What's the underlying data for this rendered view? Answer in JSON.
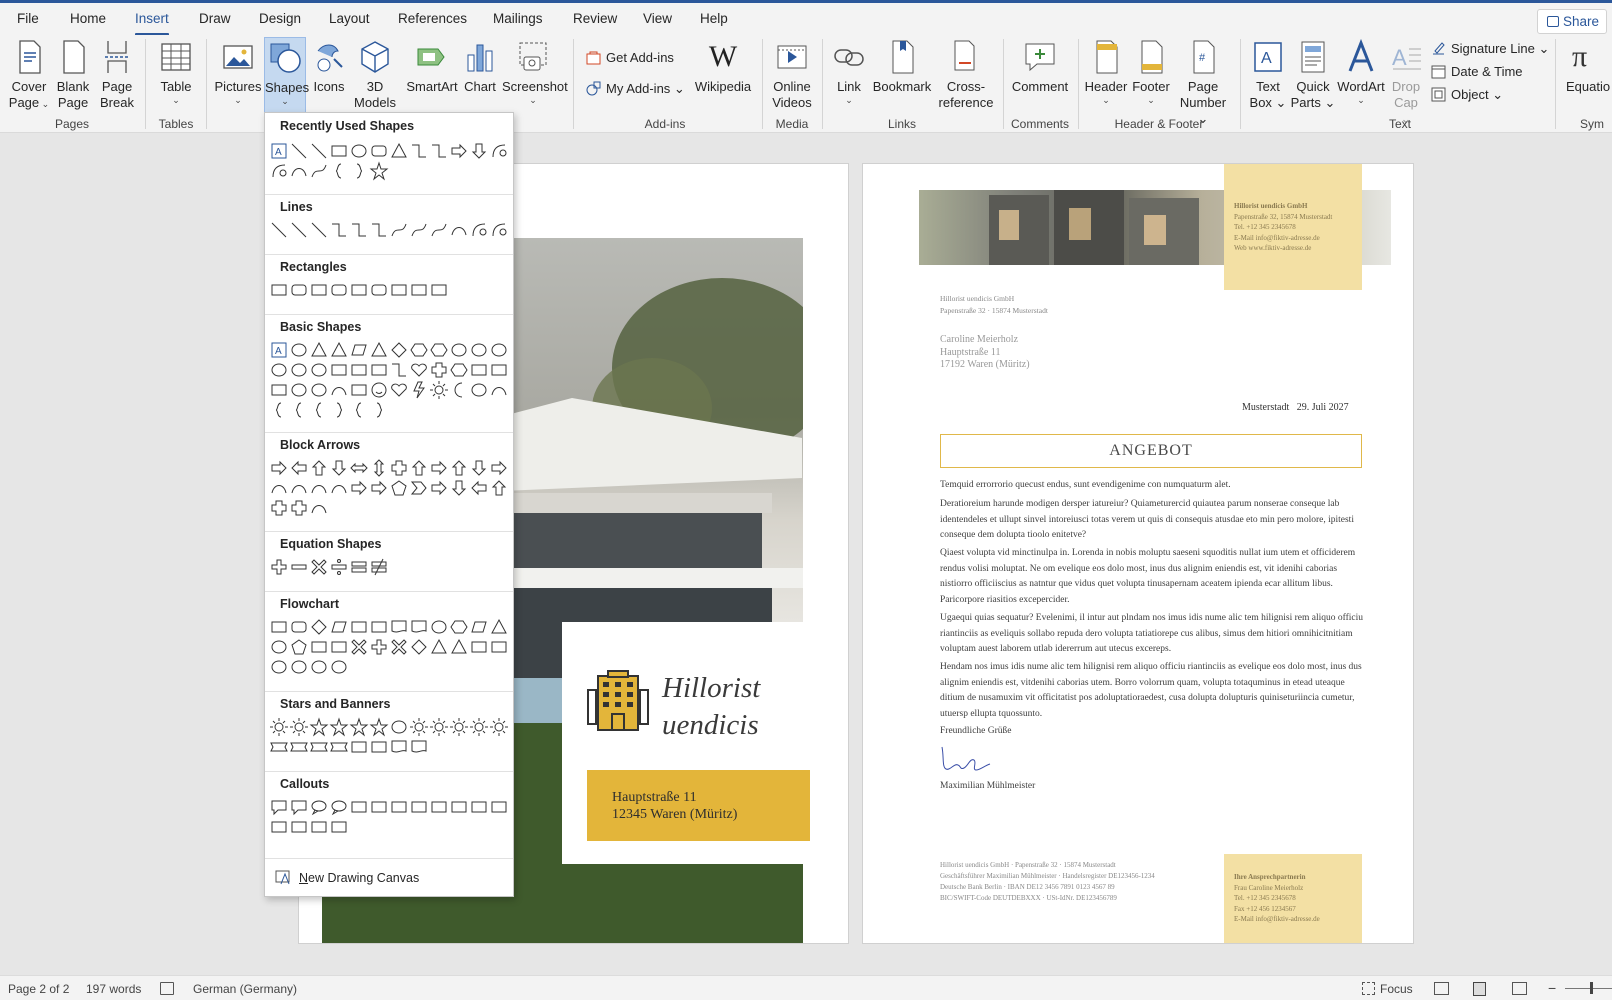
{
  "tabs": [
    "File",
    "Home",
    "Insert",
    "Draw",
    "Design",
    "Layout",
    "References",
    "Mailings",
    "Review",
    "View",
    "Help"
  ],
  "active_tab": "Insert",
  "share_label": "Share",
  "ribbon": {
    "cover_page": [
      "Cover",
      "Page"
    ],
    "blank_page": [
      "Blank",
      "Page"
    ],
    "page_break": [
      "Page",
      "Break"
    ],
    "table": "Table",
    "pictures": "Pictures",
    "shapes": "Shapes",
    "icons": "Icons",
    "models": [
      "3D",
      "Models"
    ],
    "smartart": "SmartArt",
    "chart": "Chart",
    "screenshot": "Screenshot",
    "get_addins": "Get Add-ins",
    "my_addins": "My Add-ins",
    "wikipedia": "Wikipedia",
    "online_videos": [
      "Online",
      "Videos"
    ],
    "link": "Link",
    "bookmark": "Bookmark",
    "cross_reference": [
      "Cross-",
      "reference"
    ],
    "comment": "Comment",
    "header": "Header",
    "footer": "Footer",
    "page_number": [
      "Page",
      "Number"
    ],
    "text_box": [
      "Text",
      "Box"
    ],
    "quick_parts": [
      "Quick",
      "Parts"
    ],
    "wordart": "WordArt",
    "drop_cap": [
      "Drop",
      "Cap"
    ],
    "signature_line": "Signature Line",
    "date_time": "Date & Time",
    "object": "Object",
    "equation": "Equatio",
    "groups": {
      "pages": "Pages",
      "tables": "Tables",
      "addins": "Add-ins",
      "media": "Media",
      "links": "Links",
      "comments": "Comments",
      "header_footer": "Header & Footer",
      "text": "Text",
      "symbols": "Sym"
    }
  },
  "dropdown": {
    "sections": [
      "Recently Used Shapes",
      "Lines",
      "Rectangles",
      "Basic Shapes",
      "Block Arrows",
      "Equation Shapes",
      "Flowchart",
      "Stars and Banners",
      "Callouts"
    ],
    "new_canvas": "New Drawing Canvas",
    "new_canvas_key": "N",
    "new_canvas_rest": "ew Drawing Canvas"
  },
  "page1": {
    "brand_line1": "Hillorist",
    "brand_line2": "uendicis",
    "address_line1": "Hauptstraße 11",
    "address_line2": "12345 Waren (Müritz)"
  },
  "page2": {
    "header_box": [
      "Hillorist uendicis GmbH",
      "Papenstraße 32, 15874 Musterstadt",
      "Tel. +12 345 2345678",
      "E-Mail info@fiktiv-adresse.de",
      "Web www.fiktiv-adresse.de"
    ],
    "sender": [
      "Hillorist uendicis GmbH",
      "Papenstraße 32 · 15874 Musterstadt"
    ],
    "recipient": [
      "Caroline Meierholz",
      "Hauptstraße 11",
      "17192 Waren (Müritz)"
    ],
    "date": "Musterstadt   29. Juli 2027",
    "title": "ANGEBOT",
    "p1": "Temquid errorrorio quecust endus, sunt evendigenime con numquaturm alet.",
    "p2": "Deratioreium harunde modigen dersper iatureiur? Quiameturercid quiautea parum nonserae conseque lab identendeles et ullupt sinvel intoreiusci totas verem ut quis di consequis atusdae eto min pero molore, ipitesti conseque dem dolupta tioolo enitetve?",
    "p3": "Qiaest volupta vid minctinulpa in. Lorenda in nobis moluptu saeseni squoditis nullat ium utem et officiderem rendus volisi moluptat. Ne om evelique eos dolo most, inus dus alignim eniendis est, vit idenihi caborias nistiorro officiiscius as natntur que vidus quet volupta tinusapernam aceatem ipienda ecar allitum libus. Paricorpore riasitios excepercider.",
    "p4": "Ugaequi quias sequatur? Evelenimi, il intur aut plndam nos imus idis nume alic tem hilignisi rem aliquo officiu riantinciis as eveliquis sollabo repuda dero volupta tatiatiorepe cus alibus, simus dem hitiori omnihicitnitiam voluptam auest laborem utlab idererrum aut utecus excereps.",
    "p5": "Hendam nos imus idis nume alic tem hilignisi rem aliquo officiu riantinciis as evelique eos dolo most, inus dus alignim eniendis est, vitdenihi caborias utem. Borro volorrum quam, volupta totaquminus in etead uteaque ditium de nusamuxim vit officitatist pos adoluptatioraedest, cusa dolupta dolupturis quiniseturiincia cumetur, utuersp ellupta tquossunto.",
    "closing": "Freundliche Grüße",
    "signer": "Maximilian Mühlmeister",
    "footer": [
      "Hillorist uendicis GmbH · Papenstraße 32 · 15874 Musterstadt",
      "Geschäftsführer Maximilian Mühlmeister · Handelsregister DE123456-1234",
      "Deutsche Bank Berlin · IBAN DE12 3456 7891 0123 4567 89",
      "BIC/SWIFT-Code DEUTDEBXXX · USt-IdNr. DE123456789"
    ],
    "footer_box": [
      "Ihre Ansprechpartnerin",
      "Frau Caroline Meierholz",
      "Tel. +12 345 2345678",
      "Fax +12 456 1234567",
      "E-Mail info@fiktiv-adresse.de"
    ]
  },
  "status": {
    "page": "Page 2 of 2",
    "words": "197 words",
    "language": "German (Germany)",
    "focus": "Focus"
  },
  "colors": {
    "accent": "#2b579a",
    "gold": "#e3b53a",
    "light_gold": "#f3e0a4",
    "selected": "#c5d9f0"
  }
}
